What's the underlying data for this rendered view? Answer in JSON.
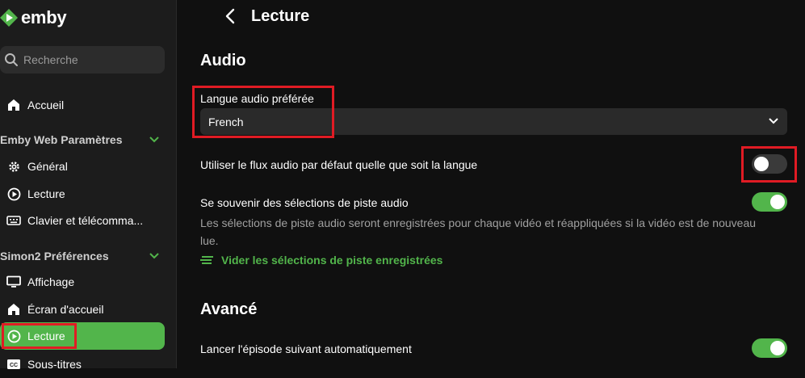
{
  "app": {
    "logo_text": "emby",
    "accent": "#52b54b",
    "highlight": "#e01b24"
  },
  "search": {
    "placeholder": "Recherche"
  },
  "sidebar": {
    "home": "Accueil",
    "section1": {
      "title": "Emby Web Paramètres",
      "items": [
        "Général",
        "Lecture",
        "Clavier et télécomma..."
      ]
    },
    "section2": {
      "title": "Simon2 Préférences",
      "items": [
        "Affichage",
        "Écran d'accueil",
        "Lecture",
        "Sous-titres"
      ]
    }
  },
  "header": {
    "title": "Lecture"
  },
  "audio": {
    "heading": "Audio",
    "language_label": "Langue audio préférée",
    "language_value": "French",
    "default_stream_label": "Utiliser le flux audio par défaut quelle que soit la langue",
    "default_stream_enabled": false,
    "remember_label": "Se souvenir des sélections de piste audio",
    "remember_enabled": true,
    "remember_desc": "Les sélections de piste audio seront enregistrées pour chaque vidéo et réappliquées si la vidéo est de nouveau lue.",
    "clear_link": "Vider les sélections de piste enregistrées"
  },
  "advanced": {
    "heading": "Avancé",
    "autoplay_label": "Lancer l'épisode suivant automatiquement",
    "autoplay_enabled": true
  }
}
